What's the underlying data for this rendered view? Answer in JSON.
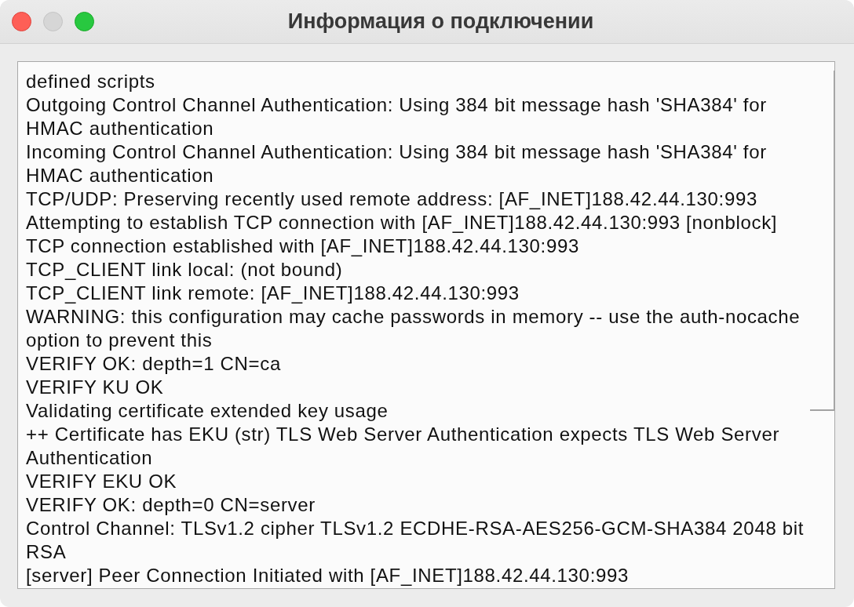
{
  "window": {
    "title": "Информация о подключении",
    "controls": [
      {
        "kind": "close",
        "disabled": false
      },
      {
        "kind": "minimize",
        "disabled": true
      },
      {
        "kind": "zoom",
        "disabled": false
      }
    ]
  },
  "log": {
    "lines": [
      "defined scripts",
      "Outgoing Control Channel Authentication: Using 384 bit message hash 'SHA384' for HMAC authentication",
      "Incoming Control Channel Authentication: Using 384 bit message hash 'SHA384' for HMAC authentication",
      "TCP/UDP: Preserving recently used remote address: [AF_INET]188.42.44.130:993",
      "Attempting to establish TCP connection with [AF_INET]188.42.44.130:993 [nonblock]",
      "TCP connection established with [AF_INET]188.42.44.130:993",
      "TCP_CLIENT link local: (not bound)",
      "TCP_CLIENT link remote: [AF_INET]188.42.44.130:993",
      "WARNING: this configuration may cache passwords in memory -- use the auth-nocache option to prevent this",
      "VERIFY OK: depth=1 CN=ca",
      "VERIFY KU OK",
      "Validating certificate extended key usage",
      "++ Certificate has EKU (str) TLS Web Server Authentication expects TLS Web Server Authentication",
      "VERIFY EKU OK",
      "VERIFY OK: depth=0 CN=server",
      "Control Channel: TLSv1.2 cipher TLSv1.2 ECDHE-RSA-AES256-GCM-SHA384 2048 bit RSA",
      "[server] Peer Connection Initiated with [AF_INET]188.42.44.130:993"
    ]
  }
}
